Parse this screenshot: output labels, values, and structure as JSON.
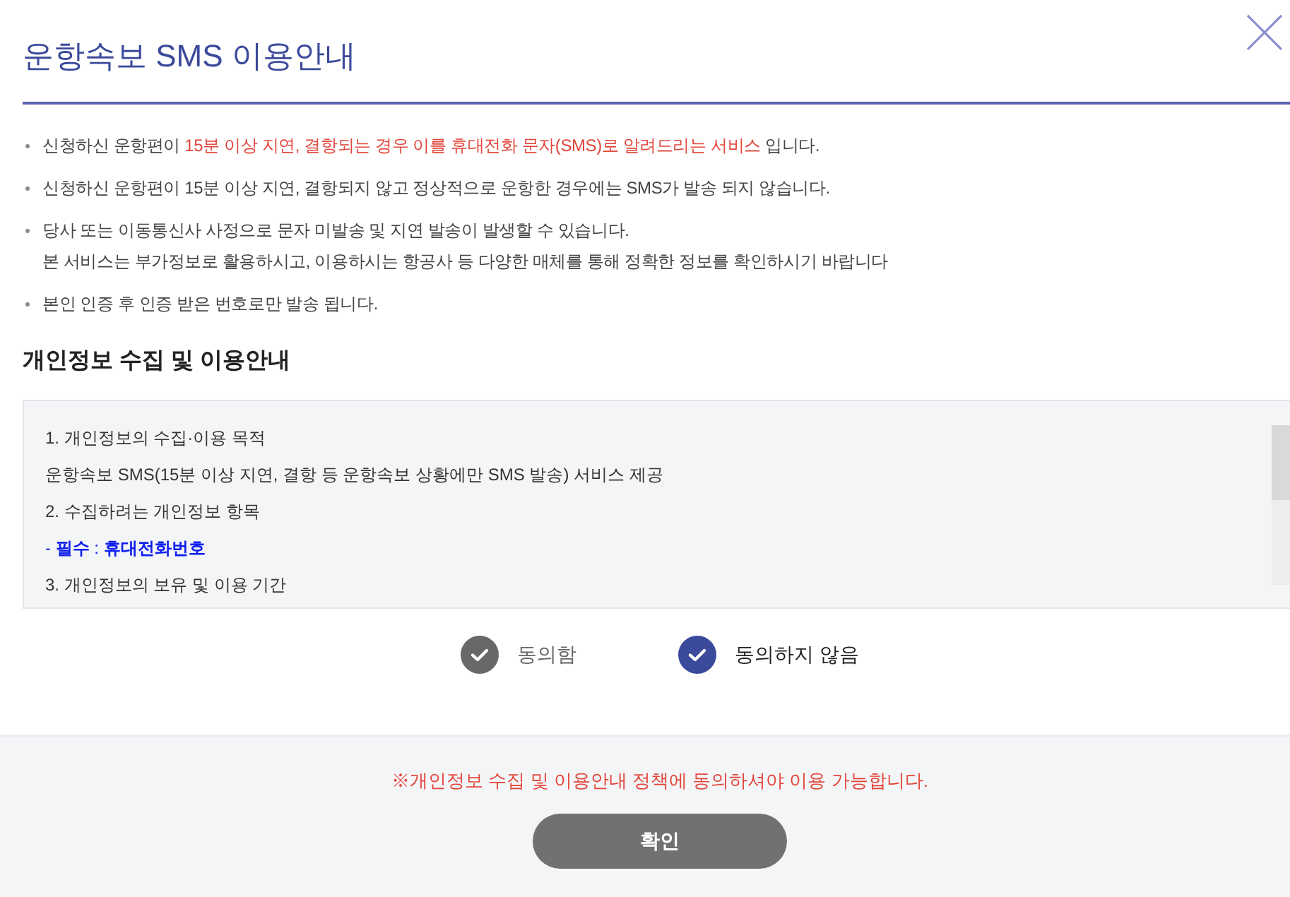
{
  "dialog": {
    "title": "운항속보 SMS 이용안내"
  },
  "notices": [
    {
      "lines": [
        [
          {
            "text": "신청하신 운항편이 ",
            "highlight": false
          },
          {
            "text": "15분 이상 지연, 결항되는 경우 이를 휴대전화 문자(SMS)로 알려드리는 서비스",
            "highlight": true
          },
          {
            "text": " 입니다.",
            "highlight": false
          }
        ]
      ]
    },
    {
      "lines": [
        [
          {
            "text": "신청하신 운항편이 15분 이상 지연, 결항되지 않고 정상적으로 운항한 경우에는 SMS가 발송 되지 않습니다.",
            "highlight": false
          }
        ]
      ]
    },
    {
      "lines": [
        [
          {
            "text": "당사 또는 이동통신사 사정으로 문자 미발송 및 지연 발송이 발생할 수 있습니다.",
            "highlight": false
          }
        ],
        [
          {
            "text": "본 서비스는 부가정보로 활용하시고, 이용하시는 항공사 등 다양한 매체를 통해 정확한 정보를 확인하시기 바랍니다",
            "highlight": false
          }
        ]
      ]
    },
    {
      "lines": [
        [
          {
            "text": "본인 인증 후 인증 받은 번호로만 발송 됩니다.",
            "highlight": false
          }
        ]
      ]
    }
  ],
  "privacy": {
    "heading": "개인정보 수집 및 이용안내",
    "lines": [
      {
        "kind": "plain",
        "text": "1. 개인정보의 수집·이용 목적"
      },
      {
        "kind": "plain",
        "text": "운항속보 SMS(15분 이상 지연, 결항 등 운항속보 상황에만 SMS 발송) 서비스 제공"
      },
      {
        "kind": "plain",
        "text": "2. 수집하려는 개인정보 항목"
      },
      {
        "kind": "required",
        "text": "- **필수** : **휴대전화번호**"
      },
      {
        "kind": "plain",
        "text": "3. 개인정보의 보유 및 이용 기간"
      }
    ]
  },
  "consent": {
    "options": [
      {
        "label": "동의함",
        "selected": false
      },
      {
        "label": "동의하지 않음",
        "selected": true
      }
    ]
  },
  "footer": {
    "notice": "※개인정보 수집 및 이용안내 정책에 동의하셔야 이용 가능합니다.",
    "button": "확인"
  }
}
